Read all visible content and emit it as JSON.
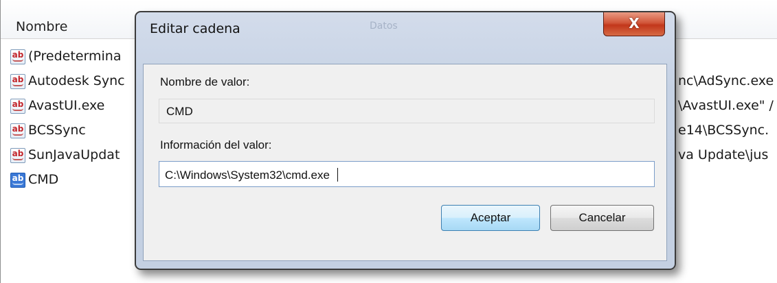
{
  "list": {
    "header_name": "Nombre",
    "header_col2": "Datos",
    "rows": [
      {
        "name": "(Predetermina",
        "value": "",
        "icon": "string-value-icon"
      },
      {
        "name": "Autodesk Sync",
        "value": "nc\\AdSync.exe",
        "icon": "string-value-icon"
      },
      {
        "name": "AvastUI.exe",
        "value": "\\AvastUI.exe\" /",
        "icon": "string-value-icon"
      },
      {
        "name": "BCSSync",
        "value": "e14\\BCSSync.",
        "icon": "string-value-icon"
      },
      {
        "name": "SunJavaUpdat",
        "value": "va Update\\jus",
        "icon": "string-value-icon"
      },
      {
        "name": "CMD",
        "value": "",
        "icon": "string-value-icon",
        "selected": true
      }
    ]
  },
  "dialog": {
    "title": "Editar cadena",
    "close_glyph": "X",
    "value_name_label": "Nombre de valor:",
    "value_name": "CMD",
    "value_data_label": "Información del valor:",
    "value_data": "C:\\Windows\\System32\\cmd.exe ",
    "ok_label": "Aceptar",
    "cancel_label": "Cancelar"
  },
  "colors": {
    "selected_icon": "#3a78d6",
    "close_button": "#c2371b",
    "dialog_frame": "#c6d2e4"
  }
}
